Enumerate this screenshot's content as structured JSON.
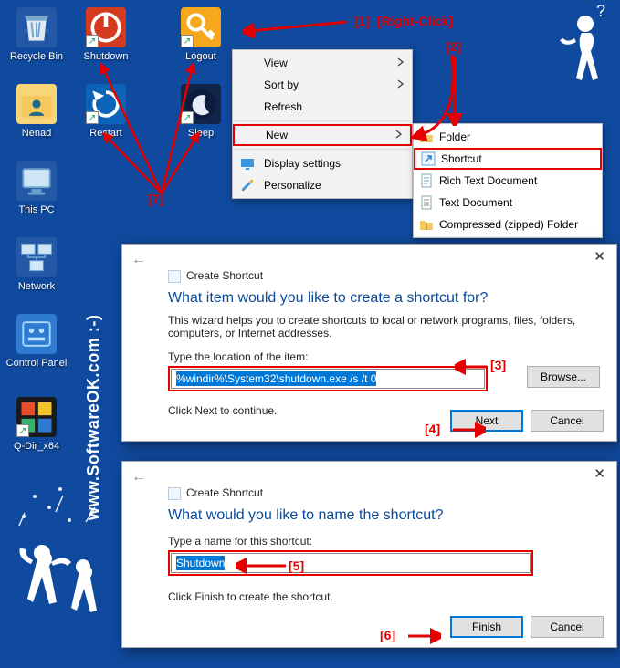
{
  "desktop_icons": {
    "recycle": "Recycle Bin",
    "shutdown": "Shutdown",
    "logout": "Logout",
    "nenad": "Nenad",
    "restart": "Restart",
    "sleep": "Sleep",
    "thispc": "This PC",
    "network": "Network",
    "controlpanel": "Control Panel",
    "qdir": "Q-Dir_x64"
  },
  "context_menu": {
    "view": "View",
    "sortby": "Sort by",
    "refresh": "Refresh",
    "new": "New",
    "display": "Display settings",
    "personalize": "Personalize"
  },
  "submenu": {
    "folder": "Folder",
    "shortcut": "Shortcut",
    "rtd": "Rich Text Document",
    "td": "Text Document",
    "zip": "Compressed (zipped) Folder"
  },
  "dialog1": {
    "title": "Create Shortcut",
    "heading": "What item would you like to create a shortcut for?",
    "desc": "This wizard helps you to create shortcuts to local or network programs, files, folders, computers, or Internet addresses.",
    "label": "Type the location of the item:",
    "value": "%windir%\\System32\\shutdown.exe /s /t 0",
    "hint": "Click Next to continue.",
    "browse": "Browse...",
    "next": "Next",
    "cancel": "Cancel"
  },
  "dialog2": {
    "title": "Create Shortcut",
    "heading": "What would you like to name the shortcut?",
    "label": "Type a name for this shortcut:",
    "value": "Shutdown",
    "hint": "Click Finish to create the shortcut.",
    "finish": "Finish",
    "cancel": "Cancel"
  },
  "annotations": {
    "a1": "[1]",
    "a1b": "[Right-Click]",
    "a2": "[2]",
    "a3": "[3]",
    "a4": "[4]",
    "a5": "[5]",
    "a6": "[6]",
    "a7": "[7]"
  },
  "watermark": "www.SoftwareOK.com  :-)",
  "colors": {
    "bg": "#104a9e",
    "red": "#e70000",
    "link": "#0a4a9a",
    "sel": "#0078d7"
  }
}
